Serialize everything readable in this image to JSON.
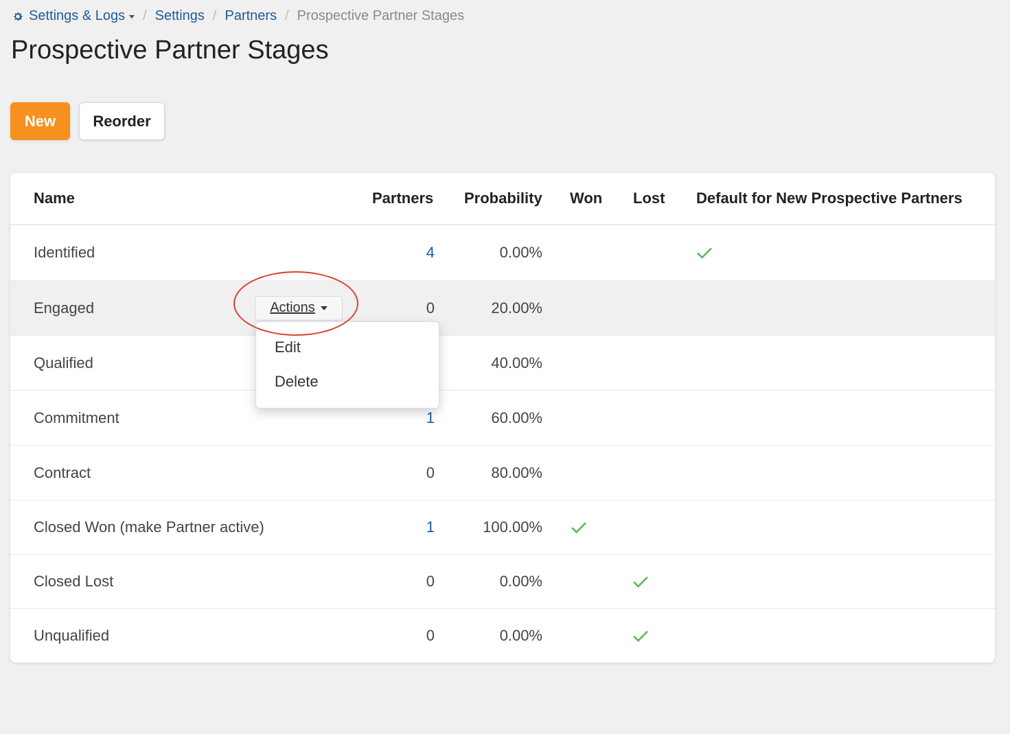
{
  "breadcrumb": {
    "root_label": "Settings & Logs",
    "settings_label": "Settings",
    "partners_label": "Partners",
    "current_label": "Prospective Partner Stages",
    "separator": "/"
  },
  "page": {
    "title": "Prospective Partner Stages"
  },
  "toolbar": {
    "new_label": "New",
    "reorder_label": "Reorder"
  },
  "table": {
    "headers": {
      "name": "Name",
      "partners": "Partners",
      "probability": "Probability",
      "won": "Won",
      "lost": "Lost",
      "default": "Default for New Prospective Partners"
    },
    "rows": [
      {
        "name": "Identified",
        "partners": "4",
        "probability": "0.00%",
        "won": false,
        "lost": false,
        "default": true
      },
      {
        "name": "Engaged",
        "partners": "0",
        "probability": "20.00%",
        "won": false,
        "lost": false,
        "default": false
      },
      {
        "name": "Qualified",
        "partners": "",
        "probability": "40.00%",
        "won": false,
        "lost": false,
        "default": false
      },
      {
        "name": "Commitment",
        "partners": "1",
        "probability": "60.00%",
        "won": false,
        "lost": false,
        "default": false
      },
      {
        "name": "Contract",
        "partners": "0",
        "probability": "80.00%",
        "won": false,
        "lost": false,
        "default": false
      },
      {
        "name": "Closed Won (make Partner active)",
        "partners": "1",
        "probability": "100.00%",
        "won": true,
        "lost": false,
        "default": false
      },
      {
        "name": "Closed Lost",
        "partners": "0",
        "probability": "0.00%",
        "won": false,
        "lost": true,
        "default": false
      },
      {
        "name": "Unqualified",
        "partners": "0",
        "probability": "0.00%",
        "won": false,
        "lost": true,
        "default": false
      }
    ]
  },
  "actions_menu": {
    "button_label": "Actions",
    "items": [
      "Edit",
      "Delete"
    ]
  },
  "colors": {
    "accent": "#f6901e",
    "link": "#1f5a96",
    "check": "#5cb85c",
    "highlight_ring": "#d9412b"
  },
  "icons": {
    "breadcrumb_root": "gear-icon",
    "boolean_true": "check-icon"
  }
}
